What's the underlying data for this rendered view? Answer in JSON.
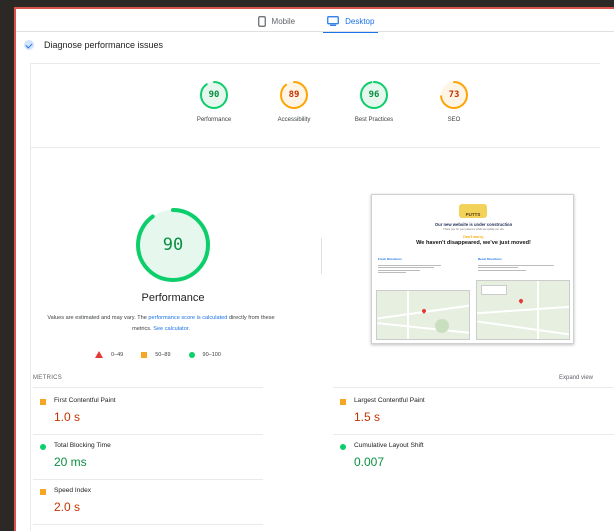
{
  "tabs": [
    {
      "label": "Mobile",
      "icon": "phone-icon",
      "active": false
    },
    {
      "label": "Desktop",
      "icon": "desktop-icon",
      "active": true
    }
  ],
  "diagnose": {
    "label": "Diagnose performance issues"
  },
  "scores": [
    {
      "value": "90",
      "label": "Performance",
      "color": "#0cce6b",
      "text_color": "#0a8f42",
      "fraction": 0.9
    },
    {
      "value": "89",
      "label": "Accessibility",
      "color": "#ffa400",
      "text_color": "#c33300",
      "fraction": 0.89
    },
    {
      "value": "96",
      "label": "Best Practices",
      "color": "#0cce6b",
      "text_color": "#0a8f42",
      "fraction": 0.96
    },
    {
      "value": "73",
      "label": "SEO",
      "color": "#ffa400",
      "text_color": "#c33300",
      "fraction": 0.73
    }
  ],
  "main_score": {
    "value": "90",
    "label": "Performance",
    "fraction": 0.9,
    "color": "#0cce6b"
  },
  "note": {
    "p1": "Values are estimated and may vary. The ",
    "link1": "performance score is calculated",
    "p2": " directly from these metrics. ",
    "link2": "See calculator."
  },
  "legend": [
    {
      "label": "0–49",
      "shape": "triangle",
      "color": "#e53935"
    },
    {
      "label": "50–89",
      "shape": "square",
      "color": "#f5a623"
    },
    {
      "label": "90–100",
      "shape": "circle",
      "color": "#0cce6b"
    }
  ],
  "screenshot": {
    "logo_text": "PUTTS",
    "heading": "Our new website is under construction",
    "sub": "Thank you for your patience while we update our site",
    "tagline": "Don't worry,",
    "headline": "We haven't disappeared, we've just moved!",
    "left_title": "Fresh Directions",
    "right_title": "Reset Directions"
  },
  "metrics": {
    "header": "METRICS",
    "expand": "Expand view",
    "items": [
      {
        "name": "First Contentful Paint",
        "value": "1.0 s",
        "icon": "orange-square-icon",
        "status": "average"
      },
      {
        "name": "Largest Contentful Paint",
        "value": "1.5 s",
        "icon": "orange-square-icon",
        "status": "average"
      },
      {
        "name": "Total Blocking Time",
        "value": "20 ms",
        "icon": "green-circle-icon",
        "status": "good"
      },
      {
        "name": "Cumulative Layout Shift",
        "value": "0.007",
        "icon": "green-circle-icon",
        "status": "good"
      },
      {
        "name": "Speed Index",
        "value": "2.0 s",
        "icon": "orange-square-icon",
        "status": "average"
      }
    ]
  }
}
